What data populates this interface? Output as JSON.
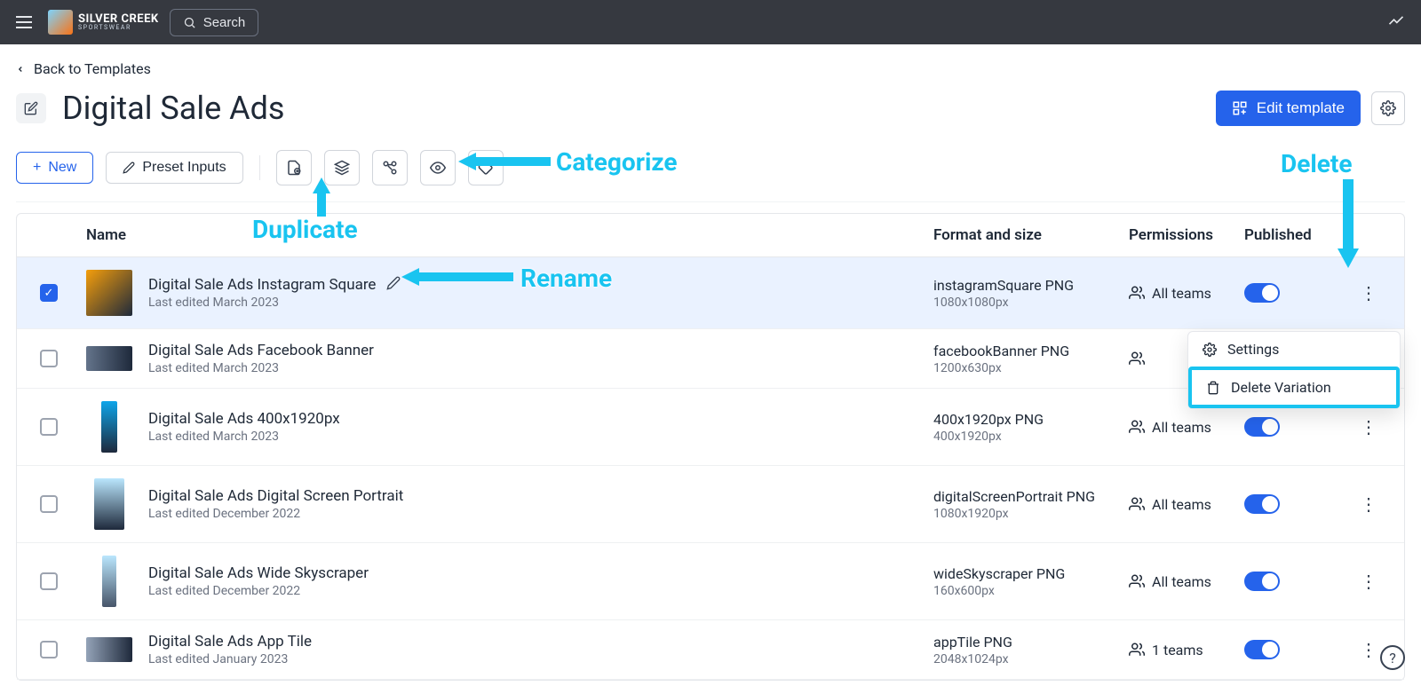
{
  "brand": {
    "line1": "SILVER",
    "line2": "CREEK",
    "sub": "SPORTSWEAR"
  },
  "topbar": {
    "search_label": "Search"
  },
  "back_link": "Back to Templates",
  "page_title": "Digital Sale Ads",
  "actions": {
    "edit_template": "Edit template"
  },
  "toolbar": {
    "new": "New",
    "preset_inputs": "Preset Inputs"
  },
  "columns": {
    "name": "Name",
    "format": "Format and size",
    "permissions": "Permissions",
    "published": "Published"
  },
  "perm_all_teams": "All teams",
  "perm_one_team": "1 teams",
  "rows": [
    {
      "selected": true,
      "thumb": "square",
      "name": "Digital Sale Ads Instagram Square",
      "edited": "Last edited March 2023",
      "format": "instagramSquare PNG",
      "size": "1080x1080px",
      "perm": "All teams",
      "published": true,
      "show_pencil": true
    },
    {
      "selected": false,
      "thumb": "banner",
      "name": "Digital Sale Ads Facebook Banner",
      "edited": "Last edited March 2023",
      "format": "facebookBanner PNG",
      "size": "1200x630px",
      "perm": "",
      "published": false,
      "show_pencil": false
    },
    {
      "selected": false,
      "thumb": "tall",
      "name": "Digital Sale Ads 400x1920px",
      "edited": "Last edited March 2023",
      "format": "400x1920px PNG",
      "size": "400x1920px",
      "perm": "All teams",
      "published": true,
      "show_pencil": false
    },
    {
      "selected": false,
      "thumb": "portrait",
      "name": "Digital Sale Ads Digital Screen Portrait",
      "edited": "Last edited December 2022",
      "format": "digitalScreenPortrait PNG",
      "size": "1080x1920px",
      "perm": "All teams",
      "published": true,
      "show_pencil": false
    },
    {
      "selected": false,
      "thumb": "sky",
      "name": "Digital Sale Ads Wide Skyscraper",
      "edited": "Last edited December 2022",
      "format": "wideSkyscraper PNG",
      "size": "160x600px",
      "perm": "All teams",
      "published": true,
      "show_pencil": false
    },
    {
      "selected": false,
      "thumb": "tile",
      "name": "Digital Sale Ads App Tile",
      "edited": "Last edited January 2023",
      "format": "appTile PNG",
      "size": "2048x1024px",
      "perm": "1 teams",
      "published": true,
      "show_pencil": false
    }
  ],
  "menu": {
    "settings": "Settings",
    "delete_variation": "Delete Variation"
  },
  "callouts": {
    "categorize": "Categorize",
    "duplicate": "Duplicate",
    "rename": "Rename",
    "delete": "Delete"
  }
}
